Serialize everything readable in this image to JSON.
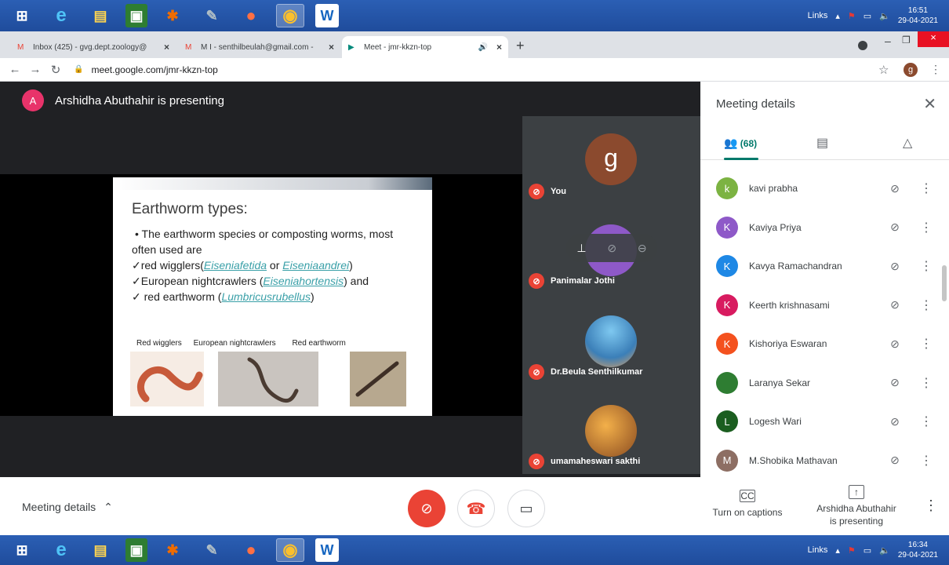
{
  "taskbar_top": {
    "links": "Links",
    "time": "16:51",
    "date": "29-04-2021"
  },
  "taskbar_bottom": {
    "links": "Links",
    "time": "16:34",
    "date": "29-04-2021"
  },
  "tabs": [
    {
      "label": "Inbox (425) - gvg.dept.zoology@"
    },
    {
      "label": "M I - senthilbeulah@gmail.com -"
    },
    {
      "label": "Meet - jmr-kkzn-top"
    }
  ],
  "address": {
    "url": "meet.google.com/jmr-kkzn-top"
  },
  "presenter": {
    "initial": "A",
    "text": "Arshidha Abuthahir is presenting"
  },
  "slide": {
    "title": "Earthworm types:",
    "bullet": "• The earthworm species or composting worms, most",
    "line2": "often used are",
    "l3a": "✓red wigglers(",
    "l3b": "Eiseniafetida",
    "l3c": " or ",
    "l3d": "Eiseniaandrei",
    "l3e": ")",
    "l4a": "✓European nightcrawlers (",
    "l4b": "Eiseniahortensis",
    "l4c": ") and",
    "l5a": "✓ red earthworm (",
    "l5b": "Lumbricusrubellus",
    "l5c": ")",
    "pic1": "Red wigglers",
    "pic2": "European nightcrawlers",
    "pic3": "Red earthworm"
  },
  "tiles": [
    {
      "name": "You",
      "initial": "g"
    },
    {
      "name": "Panimalar Jothi"
    },
    {
      "name": "Dr.Beula Senthilkumar"
    },
    {
      "name": "umamaheswari sakthi"
    }
  ],
  "sidebar": {
    "title": "Meeting details",
    "people_count": "(68)",
    "people": [
      {
        "initial": "k",
        "name": "kavi prabha",
        "color": "#7cb342"
      },
      {
        "initial": "K",
        "name": "Kaviya Priya",
        "color": "#8e59c8"
      },
      {
        "initial": "K",
        "name": "Kavya Ramachandran",
        "color": "#1e88e5"
      },
      {
        "initial": "K",
        "name": "Keerth krishnasami",
        "color": "#d81b60"
      },
      {
        "initial": "K",
        "name": "Kishoriya Eswaran",
        "color": "#f4511e"
      },
      {
        "initial": "",
        "name": "Laranya Sekar",
        "color": "#2e7d32"
      },
      {
        "initial": "L",
        "name": "Logesh Wari",
        "color": "#1b5e20"
      },
      {
        "initial": "M",
        "name": "M.Shobika Mathavan",
        "color": "#8d6e63"
      }
    ]
  },
  "controls": {
    "meeting_details": "Meeting details",
    "captions": "Turn on captions",
    "presenting_line1": "Arshidha Abuthahir",
    "presenting_line2": "is presenting"
  }
}
